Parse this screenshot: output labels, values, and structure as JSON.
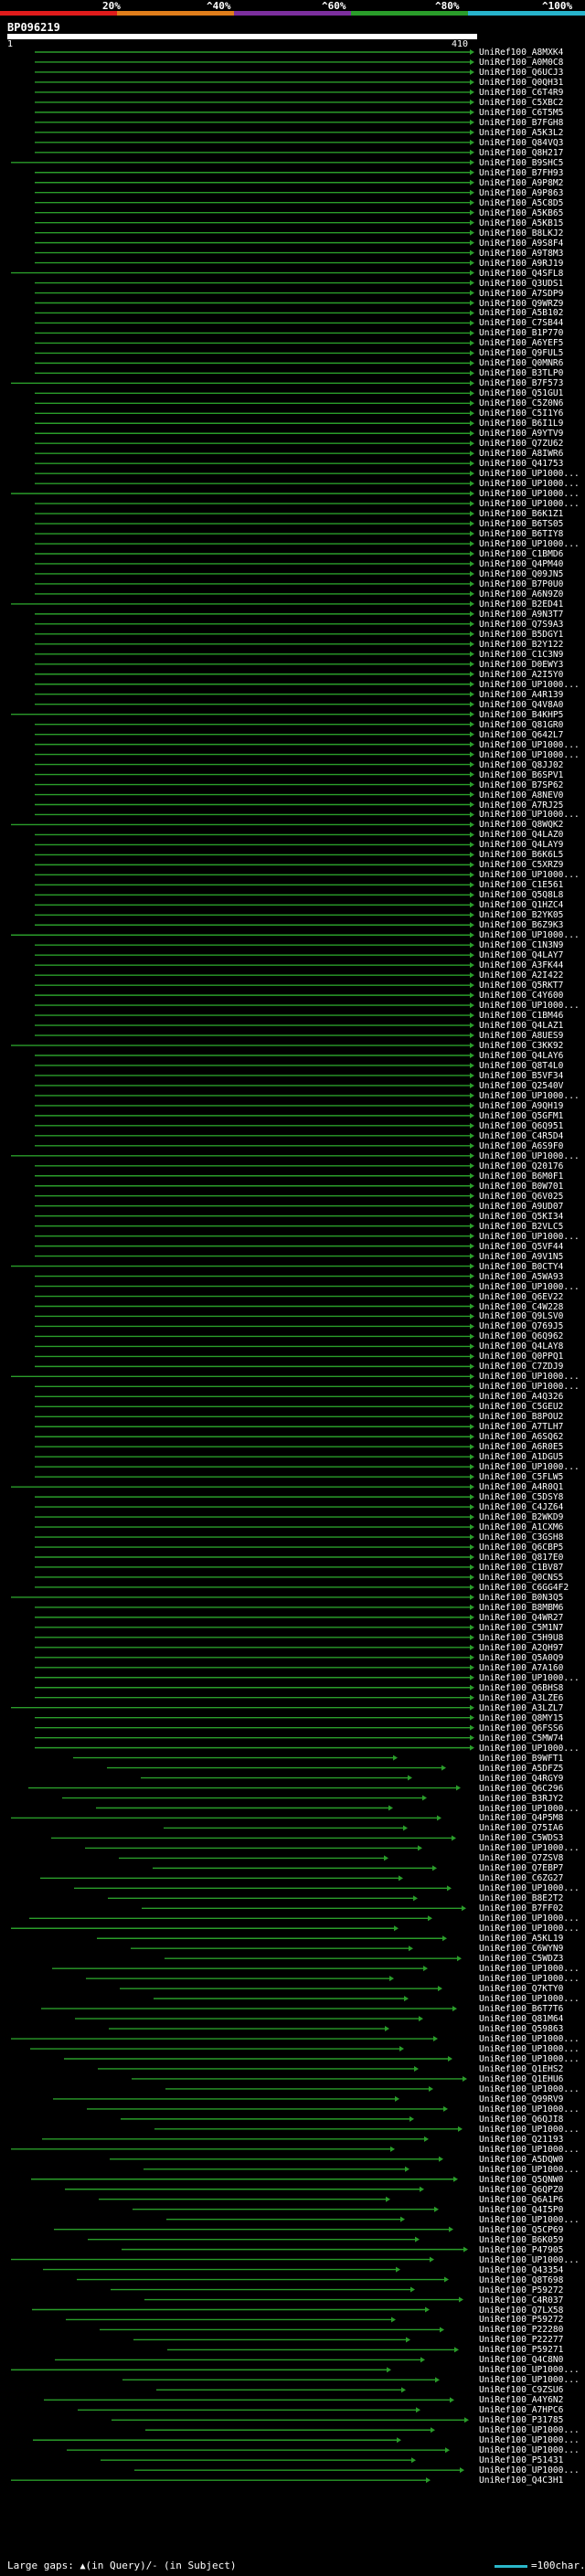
{
  "header": {
    "percent_labels": [
      "20%",
      "^40%",
      "^60%",
      "^80%",
      "^100%"
    ],
    "color_bands": [
      "#e01b1b",
      "#e07e1b",
      "#7c2f9e",
      "#2a9d2a",
      "#27b3cc"
    ]
  },
  "query": {
    "id": "BP096219",
    "start": "1",
    "end": "410"
  },
  "hits": [
    "UniRef100_A8MXK4",
    "UniRef100_A0M0C8",
    "UniRef100_Q6UCJ3",
    "UniRef100_Q0QH31",
    "UniRef100_C6T4R9",
    "UniRef100_C5XBC2",
    "UniRef100_C6T5M5",
    "UniRef100_B7FGH8",
    "UniRef100_A5K3L2",
    "UniRef100_Q84VQ3",
    "UniRef100_Q8H217",
    "UniRef100_B9SHC5",
    "UniRef100_B7FH93",
    "UniRef100_A9P8M2",
    "UniRef100_A9P863",
    "UniRef100_A5C8D5",
    "UniRef100_A5KB65",
    "UniRef100_A5KB15",
    "UniRef100_B8LKJ2",
    "UniRef100_A9S8F4",
    "UniRef100_A9T8M3",
    "UniRef100_A9RJ19",
    "UniRef100_Q4SFL8",
    "UniRef100_Q3UDS1",
    "UniRef100_A7SDP9",
    "UniRef100_Q9WRZ9",
    "UniRef100_A5B102",
    "UniRef100_C7SB44",
    "UniRef100_B1P770",
    "UniRef100_A6YEF5",
    "UniRef100_Q9FUL5",
    "UniRef100_Q0MNR6",
    "UniRef100_B3TLP0",
    "UniRef100_B7F573",
    "UniRef100_Q51GU1",
    "UniRef100_C5Z0N6",
    "UniRef100_C5I1Y6",
    "UniRef100_B6I1L9",
    "UniRef100_A9YTV9",
    "UniRef100_Q7ZU62",
    "UniRef100_A8IWR6",
    "UniRef100_Q41753",
    "UniRef100_UP1000...",
    "UniRef100_UP1000...",
    "UniRef100_UP1000...",
    "UniRef100_UP1000...",
    "UniRef100_B6K1Z1",
    "UniRef100_B6TS05",
    "UniRef100_B6TIY8",
    "UniRef100_UP1000...",
    "UniRef100_C1BMD6",
    "UniRef100_Q4PM40",
    "UniRef100_Q09JN5",
    "UniRef100_B7P0U0",
    "UniRef100_A6N9Z0",
    "UniRef100_B2ED41",
    "UniRef100_A9N3T7",
    "UniRef100_Q7S9A3",
    "UniRef100_B5DGY1",
    "UniRef100_B2Y122",
    "UniRef100_C1C3N9",
    "UniRef100_D0EWY3",
    "UniRef100_A2I5Y0",
    "UniRef100_UP1000...",
    "UniRef100_A4R139",
    "UniRef100_Q4V8A0",
    "UniRef100_B4KHP5",
    "UniRef100_Q81GR0",
    "UniRef100_Q642L7",
    "UniRef100_UP1000...",
    "UniRef100_UP1000...",
    "UniRef100_Q8JJ02",
    "UniRef100_B6SPV1",
    "UniRef100_B7SP62",
    "UniRef100_A8NEV0",
    "UniRef100_A7RJ25",
    "UniRef100_UP1000...",
    "UniRef100_Q8WQK2",
    "UniRef100_Q4LAZ0",
    "UniRef100_Q4LAY9",
    "UniRef100_B6K6L5",
    "UniRef100_C5XRZ9",
    "UniRef100_UP1000...",
    "UniRef100_C1E561",
    "UniRef100_Q5Q8L8",
    "UniRef100_Q1HZC4",
    "UniRef100_B2YK05",
    "UniRef100_B6Z9K3",
    "UniRef100_UP1000...",
    "UniRef100_C1N3N9",
    "UniRef100_Q4LAY7",
    "UniRef100_A3FK44",
    "UniRef100_A2I422",
    "UniRef100_Q5RKT7",
    "UniRef100_C4Y600",
    "UniRef100_UP1000...",
    "UniRef100_C1BM46",
    "UniRef100_Q4LAZ1",
    "UniRef100_A8UES9",
    "UniRef100_C3KK92",
    "UniRef100_Q4LAY6",
    "UniRef100_Q8T4L0",
    "UniRef100_B5VF34",
    "UniRef100_Q2540V",
    "UniRef100_UP1000...",
    "UniRef100_A9QH19",
    "UniRef100_Q5GFM1",
    "UniRef100_Q6Q951",
    "UniRef100_C4R5D4",
    "UniRef100_A6S9F0",
    "UniRef100_UP1000...",
    "UniRef100_Q20176",
    "UniRef100_B6M0F1",
    "UniRef100_B0W701",
    "UniRef100_Q6V025",
    "UniRef100_A9UD07",
    "UniRef100_Q5KI34",
    "UniRef100_B2VLC5",
    "UniRef100_UP1000...",
    "UniRef100_Q5VF44",
    "UniRef100_A9V1N5",
    "UniRef100_B0CTY4",
    "UniRef100_A5WA93",
    "UniRef100_UP1000...",
    "UniRef100_Q6EV22",
    "UniRef100_C4W228",
    "UniRef100_Q9LSV0",
    "UniRef100_Q769J5",
    "UniRef100_Q6Q962",
    "UniRef100_Q4LAY8",
    "UniRef100_Q0PPQ1",
    "UniRef100_C7ZDJ9",
    "UniRef100_UP1000...",
    "UniRef100_UP1000...",
    "UniRef100_A4Q326",
    "UniRef100_C5GEU2",
    "UniRef100_B8POU2",
    "UniRef100_A7TLH7",
    "UniRef100_A6SQ62",
    "UniRef100_A6R0E5",
    "UniRef100_A1DGU5",
    "UniRef100_UP1000...",
    "UniRef100_C5FLW5",
    "UniRef100_A4R0Q1",
    "UniRef100_C5DSY8",
    "UniRef100_C4JZ64",
    "UniRef100_B2WKD9",
    "UniRef100_A1CXM6",
    "UniRef100_C3GSH8",
    "UniRef100_Q6CBP5",
    "UniRef100_Q817E0",
    "UniRef100_C1BV87",
    "UniRef100_Q0CNS5",
    "UniRef100_C6GG4F2",
    "UniRef100_B0N3Q5",
    "UniRef100_B8MBM6",
    "UniRef100_Q4WR27",
    "UniRef100_C5M1N7",
    "UniRef100_C5H9U8",
    "UniRef100_A2QH97",
    "UniRef100_Q5A0Q9",
    "UniRef100_A7A160",
    "UniRef100_UP1000...",
    "UniRef100_Q6BHS8",
    "UniRef100_A3LZE6",
    "UniRef100_A3LZL7",
    "UniRef100_Q8MY15",
    "UniRef100_Q6FSS6",
    "UniRef100_C5MW74",
    "UniRef100_UP1000...",
    "UniRef100_B9WFT1",
    "UniRef100_A5DFZ5",
    "UniRef100_Q4RGY9",
    "UniRef100_Q6C296",
    "UniRef100_B3RJY2",
    "UniRef100_UP1000...",
    "UniRef100_Q4P5M8",
    "UniRef100_Q75IA6",
    "UniRef100_C5WDS3",
    "UniRef100_UP1000...",
    "UniRef100_Q7ZSV8",
    "UniRef100_Q7EBP7",
    "UniRef100_C6ZG27",
    "UniRef100_UP1000...",
    "UniRef100_B8E2T2",
    "UniRef100_B7FF02",
    "UniRef100_UP1000...",
    "UniRef100_UP1000...",
    "UniRef100_A5KL19",
    "UniRef100_C6WYN9",
    "UniRef100_C5WDZ3",
    "UniRef100_UP1000...",
    "UniRef100_UP1000...",
    "UniRef100_Q7KTY0",
    "UniRef100_UP1000...",
    "UniRef100_B6T7T6",
    "UniRef100_Q81M64",
    "UniRef100_Q59863",
    "UniRef100_UP1000...",
    "UniRef100_UP1000...",
    "UniRef100_UP1000...",
    "UniRef100_Q1EHS2",
    "UniRef100_Q1EHU6",
    "UniRef100_UP1000...",
    "UniRef100_Q99RV9",
    "UniRef100_UP1000...",
    "UniRef100_Q6QJI8",
    "UniRef100_UP1000...",
    "UniRef100_Q21193",
    "UniRef100_UP1000...",
    "UniRef100_A5DQW0",
    "UniRef100_UP1000...",
    "UniRef100_Q5QNW0",
    "UniRef100_Q6QPZ0",
    "UniRef100_Q6A1P6",
    "UniRef100_Q4I5P0",
    "UniRef100_UP1000...",
    "UniRef100_Q5CP69",
    "UniRef100_B6K059",
    "UniRef100_P47905",
    "UniRef100_UP1000...",
    "UniRef100_Q43354",
    "UniRef100_Q8T698",
    "UniRef100_P59272",
    "UniRef100_C4R037",
    "UniRef100_Q7LX58",
    "UniRef100_P59272",
    "UniRef100_P22280",
    "UniRef100_P22277",
    "UniRef100_P59271",
    "UniRef100_Q4C8N0",
    "UniRef100_UP1000...",
    "UniRef100_UP1000...",
    "UniRef100_C9ZSU6",
    "UniRef100_A4Y6N2",
    "UniRef100_A7HPC6",
    "UniRef100_P31785",
    "UniRef100_UP1000...",
    "UniRef100_UP1000...",
    "UniRef100_UP1000...",
    "UniRef100_P51431",
    "UniRef100_UP1000...",
    "UniRef100_Q4C3H1"
  ],
  "legend": {
    "text": "Large gaps: ",
    "symbols": "(in Query)/",
    "subject": " (in Subject)",
    "scale": "=100char."
  }
}
